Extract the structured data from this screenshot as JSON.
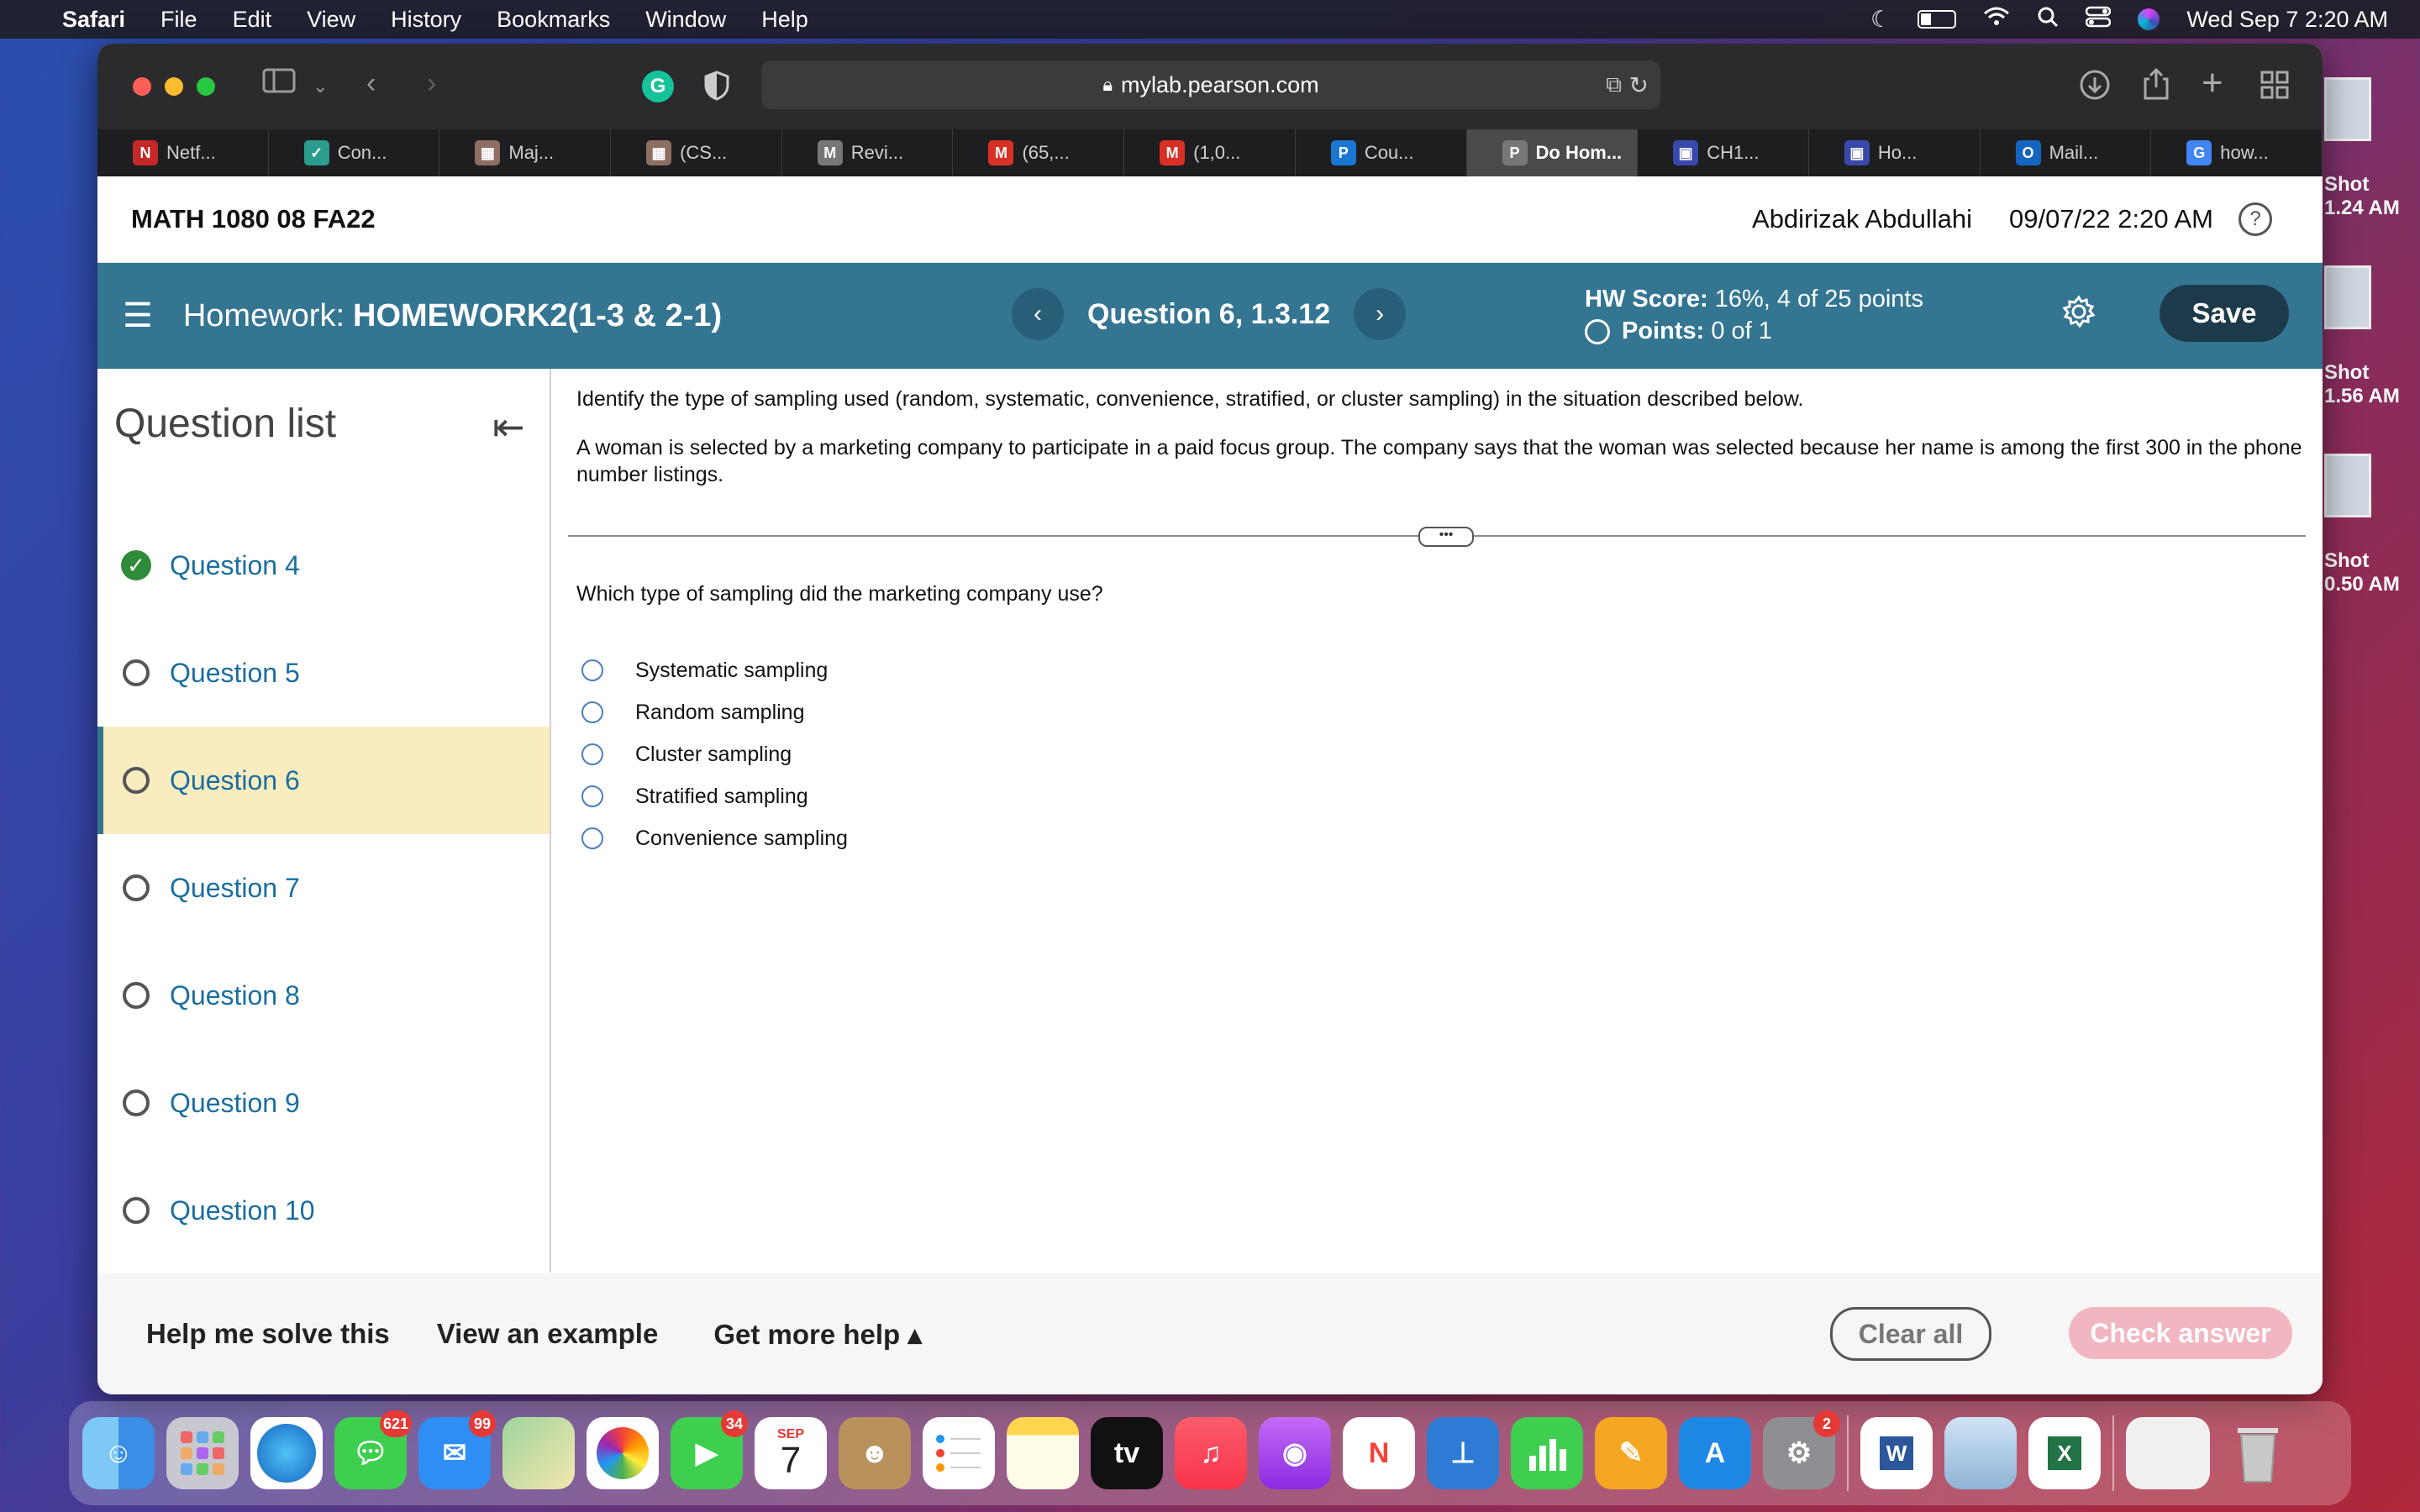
{
  "menubar": {
    "app": "Safari",
    "items": [
      "File",
      "Edit",
      "View",
      "History",
      "Bookmarks",
      "Window",
      "Help"
    ],
    "clock": "Wed Sep 7  2:20 AM"
  },
  "desktop": {
    "items": [
      {
        "line1": "Shot",
        "line2": "1.24 AM"
      },
      {
        "line1": "Shot",
        "line2": "1.56 AM"
      },
      {
        "line1": "Shot",
        "line2": "0.50 AM"
      }
    ]
  },
  "browser": {
    "url": "mylab.pearson.com",
    "tabs": [
      {
        "label": "Netf...",
        "icon": "N",
        "color": "#c62828"
      },
      {
        "label": "Con...",
        "icon": "✓",
        "color": "#2a9d8f"
      },
      {
        "label": "Maj...",
        "icon": "▦",
        "color": "#8d6e63"
      },
      {
        "label": "(CS...",
        "icon": "▦",
        "color": "#8d6e63"
      },
      {
        "label": "Revi...",
        "icon": "M",
        "color": "#777"
      },
      {
        "label": "(65,...",
        "icon": "M",
        "color": "#d93025"
      },
      {
        "label": "(1,0...",
        "icon": "M",
        "color": "#d93025"
      },
      {
        "label": "Cou...",
        "icon": "P",
        "color": "#1976d2"
      },
      {
        "label": "Do Hom...",
        "icon": "P",
        "color": "#777"
      },
      {
        "label": "CH1...",
        "icon": "▣",
        "color": "#3949ab"
      },
      {
        "label": "Ho...",
        "icon": "▣",
        "color": "#3949ab"
      },
      {
        "label": "Mail...",
        "icon": "O",
        "color": "#1565c0"
      },
      {
        "label": "how...",
        "icon": "G",
        "color": "#4285f4"
      }
    ]
  },
  "course": {
    "title": "MATH 1080 08 FA22",
    "user": "Abdirizak Abdullahi",
    "datetime": "09/07/22 2:20 AM"
  },
  "homework": {
    "label": "Homework:",
    "name": "HOMEWORK2(1-3 & 2-1)",
    "question_title": "Question 6, 1.3.12",
    "hw_score_label": "HW Score:",
    "hw_score_value": "16%, 4 of 25 points",
    "points_label": "Points:",
    "points_value": "0 of 1",
    "save_label": "Save"
  },
  "sidebar": {
    "title": "Question list",
    "items": [
      {
        "label": "Question 4",
        "status": "complete"
      },
      {
        "label": "Question 5",
        "status": "open"
      },
      {
        "label": "Question 6",
        "status": "current"
      },
      {
        "label": "Question 7",
        "status": "open"
      },
      {
        "label": "Question 8",
        "status": "open"
      },
      {
        "label": "Question 9",
        "status": "open"
      },
      {
        "label": "Question 10",
        "status": "open"
      }
    ]
  },
  "question": {
    "instruction": "Identify the type of sampling used (random, systematic, convenience, stratified, or cluster sampling) in the situation described below.",
    "scenario": "A woman is selected by a marketing company to participate in a paid focus group. The company says that the woman was selected because her name is among the first 300 in the phone number listings.",
    "prompt": "Which type of sampling did the marketing company use?",
    "options": [
      "Systematic sampling",
      "Random sampling",
      "Cluster sampling",
      "Stratified sampling",
      "Convenience sampling"
    ]
  },
  "footer": {
    "help_solve": "Help me solve this",
    "view_example": "View an example",
    "more_help": "Get more help ▴",
    "clear_all": "Clear all",
    "check_answer": "Check answer"
  },
  "dock": {
    "messages_badge": "621",
    "mail_badge": "99",
    "facetime_badge": "34",
    "calendar_month": "SEP",
    "calendar_day": "7",
    "settings_badge": "2",
    "appletv_label": "tv"
  }
}
